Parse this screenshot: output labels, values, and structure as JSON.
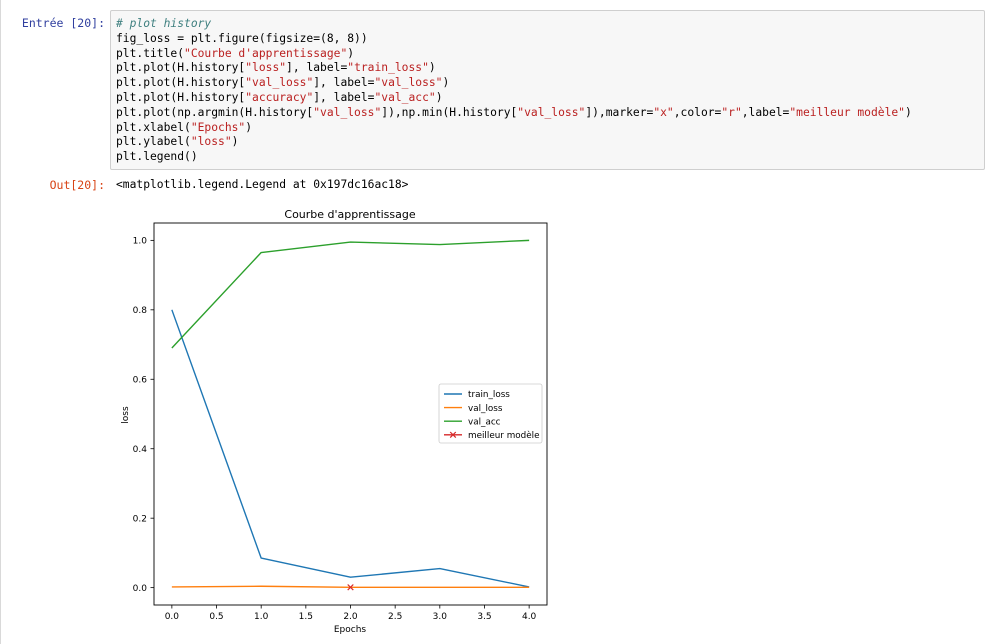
{
  "cell_in": {
    "prompt": "Entrée [20]:",
    "code_lines": [
      [
        {
          "t": "# plot history",
          "c": "comment"
        }
      ],
      [
        {
          "t": "fig_loss = plt.figure(figsize=(8, 8))"
        }
      ],
      [
        {
          "t": "plt.title("
        },
        {
          "t": "\"Courbe d'apprentissage\"",
          "c": "str"
        },
        {
          "t": ")"
        }
      ],
      [
        {
          "t": "plt.plot(H.history["
        },
        {
          "t": "\"loss\"",
          "c": "str"
        },
        {
          "t": "], label="
        },
        {
          "t": "\"train_loss\"",
          "c": "str"
        },
        {
          "t": ")"
        }
      ],
      [
        {
          "t": "plt.plot(H.history["
        },
        {
          "t": "\"val_loss\"",
          "c": "str"
        },
        {
          "t": "], label="
        },
        {
          "t": "\"val_loss\"",
          "c": "str"
        },
        {
          "t": ")"
        }
      ],
      [
        {
          "t": "plt.plot(H.history["
        },
        {
          "t": "\"accuracy\"",
          "c": "str"
        },
        {
          "t": "], label="
        },
        {
          "t": "\"val_acc\"",
          "c": "str"
        },
        {
          "t": ")"
        }
      ],
      [
        {
          "t": "plt.plot(np.argmin(H.history["
        },
        {
          "t": "\"val_loss\"",
          "c": "str"
        },
        {
          "t": "]),np.min(H.history["
        },
        {
          "t": "\"val_loss\"",
          "c": "str"
        },
        {
          "t": "]),marker="
        },
        {
          "t": "\"x\"",
          "c": "str"
        },
        {
          "t": ",color="
        },
        {
          "t": "\"r\"",
          "c": "str"
        },
        {
          "t": ",label="
        },
        {
          "t": "\"meilleur modèle\"",
          "c": "str"
        },
        {
          "t": ")"
        }
      ],
      [
        {
          "t": "plt.xlabel("
        },
        {
          "t": "\"Epochs\"",
          "c": "str"
        },
        {
          "t": ")"
        }
      ],
      [
        {
          "t": "plt.ylabel("
        },
        {
          "t": "\"loss\"",
          "c": "str"
        },
        {
          "t": ")"
        }
      ],
      [
        {
          "t": "plt.legend()"
        }
      ]
    ]
  },
  "cell_out": {
    "prompt": "Out[20]:",
    "text": "<matplotlib.legend.Legend at 0x197dc16ac18>"
  },
  "chart_data": {
    "type": "line",
    "title": "Courbe d'apprentissage",
    "xlabel": "Epochs",
    "ylabel": "loss",
    "xlim": [
      -0.2,
      4.2
    ],
    "ylim": [
      -0.05,
      1.05
    ],
    "xticks": [
      0.0,
      0.5,
      1.0,
      1.5,
      2.0,
      2.5,
      3.0,
      3.5,
      4.0
    ],
    "xtick_labels": [
      "0.0",
      "0.5",
      "1.0",
      "1.5",
      "2.0",
      "2.5",
      "3.0",
      "3.5",
      "4.0"
    ],
    "yticks": [
      0.0,
      0.2,
      0.4,
      0.6,
      0.8,
      1.0
    ],
    "ytick_labels": [
      "0.0",
      "0.2",
      "0.4",
      "0.6",
      "0.8",
      "1.0"
    ],
    "grid": false,
    "legend_position": "center-right",
    "x": [
      0,
      1,
      2,
      3,
      4
    ],
    "series": [
      {
        "name": "train_loss",
        "color": "#1f77b4",
        "values": [
          0.8,
          0.085,
          0.03,
          0.055,
          0.002
        ]
      },
      {
        "name": "val_loss",
        "color": "#ff7f0e",
        "values": [
          0.002,
          0.004,
          0.001,
          0.001,
          0.001
        ]
      },
      {
        "name": "val_acc",
        "color": "#2ca02c",
        "values": [
          0.69,
          0.965,
          0.995,
          0.988,
          1.0
        ]
      }
    ],
    "markers": [
      {
        "name": "meilleur modèle",
        "color": "#d62728",
        "marker": "x",
        "x": 2,
        "y": 0.001
      }
    ]
  }
}
